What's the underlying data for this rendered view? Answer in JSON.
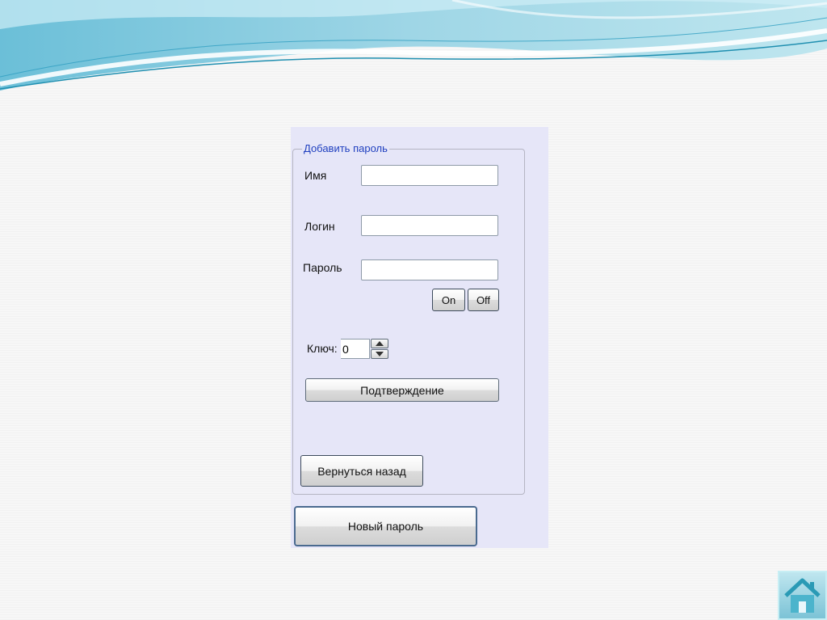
{
  "form": {
    "group_title": "Добавить пароль",
    "name_label": "Имя",
    "name_value": "",
    "login_label": "Логин",
    "login_value": "",
    "password_label": "Пароль",
    "password_value": "",
    "on_label": "On",
    "off_label": "Off",
    "key_label": "Ключ:",
    "key_value": "0",
    "confirm_label": "Подтверждение",
    "back_label": "Вернуться назад"
  },
  "new_password_label": "Новый пароль",
  "icons": {
    "home": "home-icon",
    "spin_up": "spin-up-icon",
    "spin_down": "spin-down-icon"
  },
  "colors": {
    "panel_bg": "#e6e6f8",
    "group_title": "#1f3fbf",
    "wave_dark": "#3fa8c6",
    "wave_light": "#a9dbe8"
  }
}
